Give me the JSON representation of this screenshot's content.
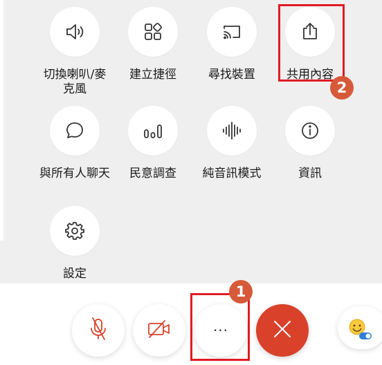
{
  "menu": {
    "items": [
      {
        "label": "切換喇叭/麥\n克風",
        "icon": "speaker-icon"
      },
      {
        "label": "建立捷徑",
        "icon": "shortcut-grid-icon"
      },
      {
        "label": "尋找裝置",
        "icon": "cast-icon"
      },
      {
        "label": "共用內容",
        "icon": "share-upload-icon"
      },
      {
        "label": "與所有人聊天",
        "icon": "chat-bubble-icon"
      },
      {
        "label": "民意調查",
        "icon": "poll-bars-icon"
      },
      {
        "label": "純音訊模式",
        "icon": "audio-waveform-icon"
      },
      {
        "label": "資訊",
        "icon": "info-icon"
      },
      {
        "label": "設定",
        "icon": "gear-icon"
      }
    ]
  },
  "controls": {
    "mute_icon": "microphone-muted-icon",
    "video_icon": "video-off-icon",
    "more_label": "···",
    "end_icon": "close-icon",
    "reactions_icon": "emoji-reactions-icon"
  },
  "annotations": {
    "step1": "1",
    "step2": "2"
  },
  "colors": {
    "panel_bg": "#efefef",
    "icon": "#333333",
    "muted_red": "#d9412b",
    "end_call": "#d9412b",
    "highlight_box": "#e01b22",
    "badge": "#d65a3a",
    "toggle_blue": "#2f7fd8"
  }
}
